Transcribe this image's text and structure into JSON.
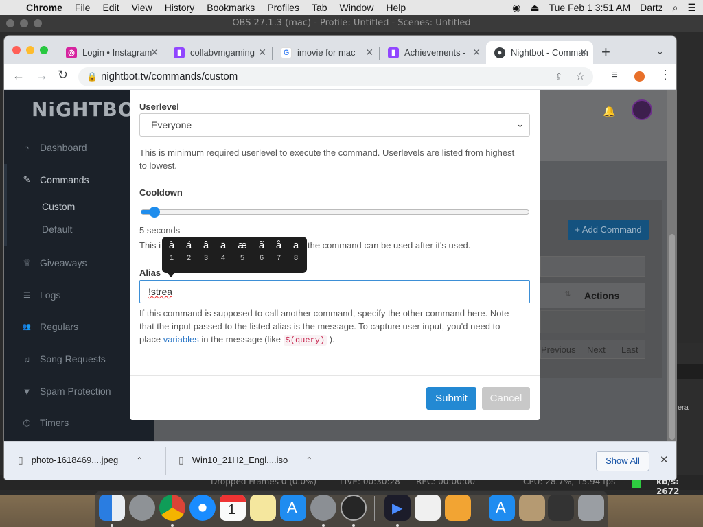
{
  "menubar": {
    "apple": "",
    "app": "Chrome",
    "items": [
      "File",
      "Edit",
      "View",
      "History",
      "Bookmarks",
      "Profiles",
      "Tab",
      "Window",
      "Help"
    ],
    "datetime": "Tue Feb 1  3:51 AM",
    "user": "Dartz"
  },
  "obs": {
    "title": "OBS 27.1.3 (mac) - Profile: Untitled - Scenes: Untitled",
    "status_dropped": "Dropped Frames 0 (0.0%)",
    "status_live": "LIVE: 00:30:28",
    "status_rec": "REC: 00:00:00",
    "status_cpu": "CPU: 28.7%, 15.94 fps",
    "status_kbs": "kb/s: 2672",
    "side_label": "era"
  },
  "chrome": {
    "tabs": [
      {
        "label": "Login • Instagram",
        "icon": "instagram-icon",
        "color": "#d6249f"
      },
      {
        "label": "collabvmgaming",
        "icon": "twitch-icon",
        "color": "#9146ff"
      },
      {
        "label": "imovie for mac",
        "icon": "google-icon",
        "color": "#4285f4"
      },
      {
        "label": "Achievements -",
        "icon": "twitch-icon",
        "color": "#9146ff"
      },
      {
        "label": "Nightbot - Commands",
        "icon": "nightbot-icon",
        "color": "#3c4043"
      }
    ],
    "url": "nightbot.tv/commands/custom"
  },
  "nightbot": {
    "logo": "NiGHTBOT",
    "sidebar": [
      {
        "label": "Dashboard",
        "icon": "dashboard-icon",
        "glyph": "◔"
      },
      {
        "label": "Commands",
        "icon": "wand-icon",
        "glyph": "✎"
      },
      {
        "label": "Custom",
        "icon": "",
        "glyph": ""
      },
      {
        "label": "Default",
        "icon": "",
        "glyph": ""
      },
      {
        "label": "Giveaways",
        "icon": "trophy-icon",
        "glyph": "♕"
      },
      {
        "label": "Logs",
        "icon": "database-icon",
        "glyph": "≣"
      },
      {
        "label": "Regulars",
        "icon": "users-icon",
        "glyph": "👥"
      },
      {
        "label": "Song Requests",
        "icon": "music-icon",
        "glyph": "♫"
      },
      {
        "label": "Spam Protection",
        "icon": "filter-icon",
        "glyph": "▼"
      },
      {
        "label": "Timers",
        "icon": "clock-icon",
        "glyph": "◷"
      }
    ],
    "add_command": "+ Add Command",
    "actions_header": "Actions",
    "pagination": [
      "Previous",
      "Next",
      "Last"
    ]
  },
  "modal": {
    "userlevel_label": "Userlevel",
    "userlevel_value": "Everyone",
    "userlevel_help": "This is minimum required userlevel to execute the command. Userlevels are listed from highest to lowest.",
    "cooldown_label": "Cooldown",
    "cooldown_value": "5 seconds",
    "cooldown_fraction": 0.02,
    "cooldown_help_start": "This i",
    "cooldown_help_end": "the command can be used after it's used.",
    "alias_label": "Alias",
    "alias_value": "!strea",
    "alias_help_1": "If this command is supposed to call another command, specify the other command here. Note that the input passed to the listed alias is the message. To capture user input, you'd need to place ",
    "alias_help_link": "variables",
    "alias_help_2": " in the message (like ",
    "alias_help_code": "$(query)",
    "alias_help_3": " ).",
    "submit": "Submit",
    "cancel": "Cancel"
  },
  "accent_popup": {
    "chars": [
      "à",
      "á",
      "â",
      "ä",
      "æ",
      "ã",
      "å",
      "ā"
    ],
    "nums": [
      "1",
      "2",
      "3",
      "4",
      "5",
      "6",
      "7",
      "8"
    ]
  },
  "downloads": {
    "items": [
      "photo-1618469....jpeg",
      "Win10_21H2_Engl....iso"
    ],
    "show_all": "Show All"
  },
  "colors": {
    "accent": "#2389d3",
    "sidebar": "#1b2129"
  }
}
